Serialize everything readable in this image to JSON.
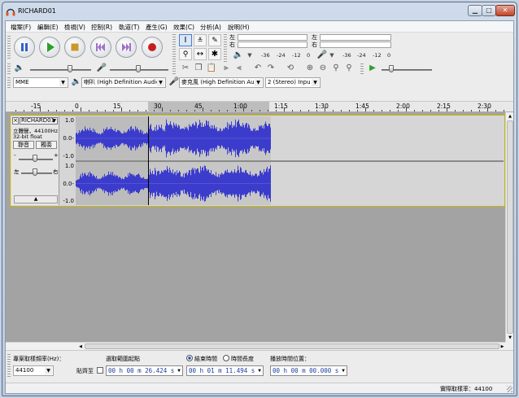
{
  "window": {
    "title": "RICHARD01"
  },
  "menu": [
    "檔案(F)",
    "編輯(E)",
    "檢視(V)",
    "控制(R)",
    "軌道(T)",
    "產生(G)",
    "效果(C)",
    "分析(A)",
    "說明(H)"
  ],
  "meters": {
    "left_label": "左",
    "right_label": "右",
    "scale": [
      "-36",
      "-24",
      "-12",
      "0"
    ]
  },
  "devices": {
    "host": "MME",
    "output": "喇叭 (High Definition Audic",
    "input": "麥克風 (High Definition Au",
    "channels": "2 (Stereo) Inpu"
  },
  "ruler": {
    "ticks": [
      "-15",
      "0",
      "15",
      "30",
      "45",
      "1:00",
      "1:15",
      "1:30",
      "1:45",
      "2:00",
      "2:15",
      "2:30"
    ]
  },
  "track": {
    "name": "RICHARD01",
    "info1": "立體聲，44100Hz",
    "info2": "32-bit float",
    "mute_label": "靜音",
    "solo_label": "獨奏",
    "gain_minus": "-",
    "gain_plus": "+",
    "pan_left": "左",
    "pan_right": "右",
    "yaxis_top": "1.0",
    "yaxis_mid": "0.0-",
    "yaxis_bot": "-1.0"
  },
  "selection": {
    "rate_label": "專案取樣頻率(Hz)：",
    "rate_value": "44100",
    "snap_label": "貼齊至",
    "start_label": "選取範圍起點",
    "end_label": "結束時間",
    "length_label": "時間長度",
    "pos_label": "播放時間位置：",
    "start_time": "00 h 00 m 26.424 s",
    "end_time": "00 h 01 m 11.494 s",
    "pos_time": "00 h 00 m 00.000 s"
  },
  "status": {
    "rate_text": "實際取樣率：44100"
  },
  "colors": {
    "wave": "#3c3ccc",
    "selection": "#c7c7c7",
    "track_border": "#c8b800"
  }
}
